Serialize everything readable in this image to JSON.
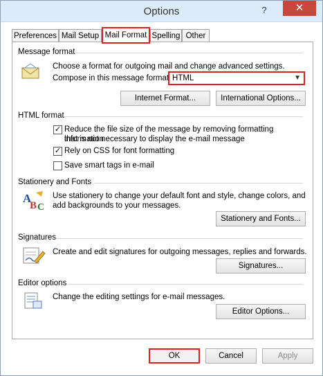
{
  "window": {
    "title": "Options",
    "help_glyph": "?",
    "close_glyph": "✕"
  },
  "tabs": [
    {
      "label": "Preferences"
    },
    {
      "label": "Mail Setup"
    },
    {
      "label": "Mail Format",
      "active": true
    },
    {
      "label": "Spelling"
    },
    {
      "label": "Other"
    }
  ],
  "message_format": {
    "title": "Message format",
    "description": "Choose a format for outgoing mail and change advanced settings.",
    "compose_label": "Compose in this message format:",
    "compose_value": "HTML",
    "internet_format_button": "Internet Format...",
    "international_options_button": "International Options..."
  },
  "html_format": {
    "title": "HTML format",
    "reduce_size_line1": "Reduce the file size of the message by removing formatting information",
    "reduce_size_line2": "that is not necessary to display the e-mail message",
    "reduce_size_checked": true,
    "rely_css_label": "Rely on CSS for font formatting",
    "rely_css_checked": true,
    "smart_tags_label": "Save smart tags in e-mail",
    "smart_tags_checked": false
  },
  "stationery": {
    "title": "Stationery and Fonts",
    "description_line1": "Use stationery to change your default font and style, change colors, and",
    "description_line2": "add backgrounds to your messages.",
    "button": "Stationery and Fonts..."
  },
  "signatures": {
    "title": "Signatures",
    "description": "Create and edit signatures for outgoing messages, replies and forwards.",
    "button": "Signatures..."
  },
  "editor": {
    "title": "Editor options",
    "description": "Change the editing settings for e-mail messages.",
    "button": "Editor Options..."
  },
  "footer": {
    "ok": "OK",
    "cancel": "Cancel",
    "apply": "Apply"
  },
  "colors": {
    "highlight": "#e02020",
    "titlebar": "#dcebfa",
    "close": "#c7473c"
  }
}
